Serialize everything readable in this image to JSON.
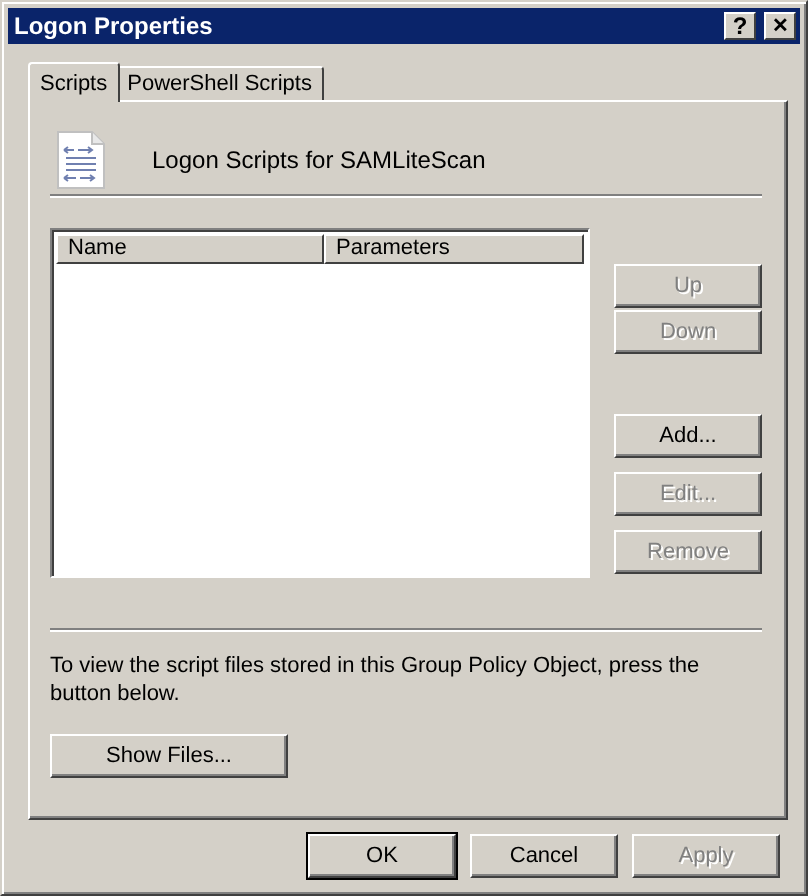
{
  "window": {
    "title": "Logon Properties",
    "title_buttons": [
      {
        "kind": "help",
        "label": "?"
      },
      {
        "kind": "close",
        "label": "✕"
      }
    ]
  },
  "tabs": [
    {
      "label": "Scripts",
      "selected": true
    },
    {
      "label": "PowerShell Scripts",
      "selected": false
    }
  ],
  "header": {
    "title": "Logon Scripts for SAMLiteScan"
  },
  "table": {
    "columns": [
      "Name",
      "Parameters"
    ]
  },
  "side_buttons": [
    {
      "label": "Up",
      "disabled": true
    },
    {
      "label": "Down",
      "disabled": true
    },
    {
      "label": "Add...",
      "disabled": false
    },
    {
      "label": "Edit...",
      "disabled": true
    },
    {
      "label": "Remove",
      "disabled": true
    }
  ],
  "info_text": "To view the script files stored in this Group Policy Object, press the button below.",
  "show_files_button": {
    "label": "Show Files..."
  },
  "buttons": [
    {
      "label": "OK",
      "default": true,
      "disabled": false
    },
    {
      "label": "Cancel",
      "default": false,
      "disabled": false
    },
    {
      "label": "Apply",
      "default": false,
      "disabled": true
    }
  ]
}
